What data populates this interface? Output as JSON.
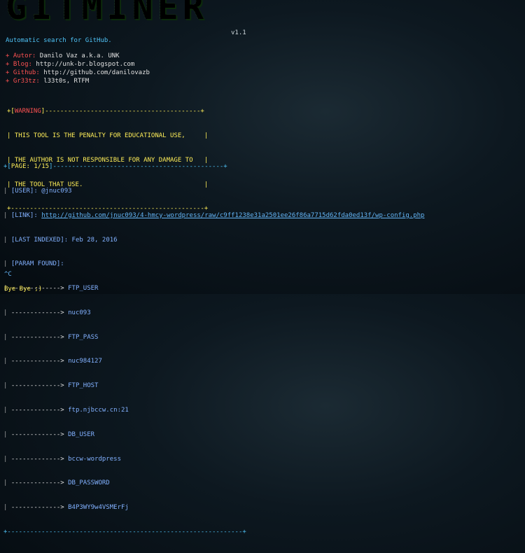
{
  "banner": {
    "title": "GITMINER",
    "version": "v1.1",
    "tagline": "Automatic search for GitHub."
  },
  "credits": [
    {
      "key": "+ Autor:",
      "value": "Danilo Vaz a.k.a. UNK"
    },
    {
      "key": "+ Blog:",
      "value": "http://unk-br.blogspot.com"
    },
    {
      "key": "+ Github:",
      "value": "http://github.com/danilovazb"
    },
    {
      "key": "+ Gr33tz:",
      "value": "l33t0s, RTFM"
    }
  ],
  "warning": {
    "top_prefix": "+[",
    "label": "WARNING",
    "top_suffix": "]-----------------------------------------+",
    "lines": [
      "| THIS TOOL IS THE PENALTY FOR EDUCATIONAL USE,     |",
      "| THE AUTHOR IS NOT RESPONSIBLE FOR ANY DAMAGE TO   |",
      "| THE TOOL THAT USE.                                |"
    ],
    "bottom": "+---------------------------------------------------+"
  },
  "page": {
    "prefix": "+[",
    "label": "PAGE: 1/15",
    "suffix": "]---------------------------------------------+",
    "user_label": "[USER]:",
    "user": "@jnuc093",
    "link_label": "[LINK]:",
    "link": "http://github.com/jnuc093/4-hmcy-wordpress/raw/c9ff1238e31a2501ee26f86a7715d62fda0ed13f/wp-config.php",
    "indexed_label": "[LAST INDEXED]:",
    "indexed": "Feb 28, 2016",
    "param_label": "[PARAM FOUND]:",
    "arrow": "------------->",
    "params": [
      "FTP_USER",
      "nuc093",
      "FTP_PASS",
      "nuc984127",
      "FTP_HOST",
      "ftp.njbccw.cn:21",
      "DB_USER",
      "bccw-wordpress",
      "DB_PASSWORD",
      "B4P3WY9w4VSMErFj"
    ],
    "bottom": "+--------------------------------------------------------------+"
  },
  "footer": {
    "interrupt": "^C",
    "bye": "Bye Bye ;)"
  }
}
